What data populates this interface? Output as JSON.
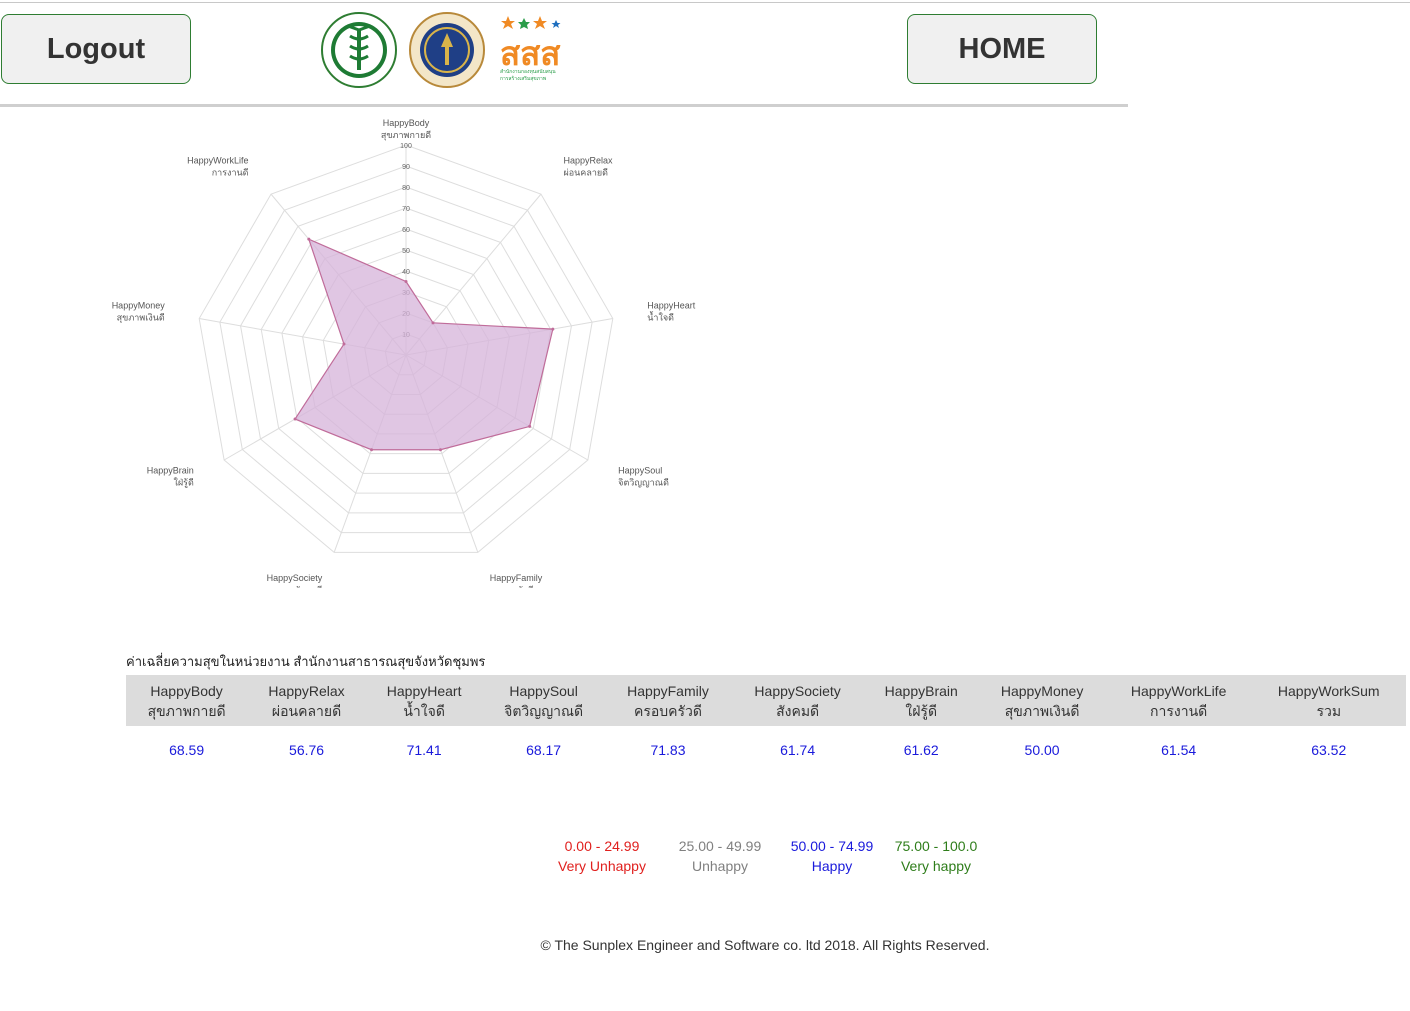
{
  "header": {
    "logout_label": "Logout",
    "home_label": "HOME",
    "logo3_text": "สสส",
    "logo3_sub1": "สำนักงานกองทุนสนับสนุน",
    "logo3_sub2": "การสร้างเสริมสุขภาพ"
  },
  "chart_data": {
    "type": "radar",
    "axes": [
      {
        "en": "HappyBody",
        "th": "สุขภาพกายดี"
      },
      {
        "en": "HappyRelax",
        "th": "ผ่อนคลายดี"
      },
      {
        "en": "HappyHeart",
        "th": "น้ำใจดี"
      },
      {
        "en": "HappySoul",
        "th": "จิตวิญญาณดี"
      },
      {
        "en": "HappyFamily",
        "th": "ครอบครัวดี"
      },
      {
        "en": "HappySociety",
        "th": "สังคมดี"
      },
      {
        "en": "HappyBrain",
        "th": "ใฝ่รู้ดี"
      },
      {
        "en": "HappyMoney",
        "th": "สุขภาพเงินดี"
      },
      {
        "en": "HappyWorkLife",
        "th": "การงานดี"
      }
    ],
    "ticks": [
      10,
      20,
      30,
      40,
      50,
      60,
      70,
      80,
      90,
      100
    ],
    "range": [
      0,
      100
    ],
    "series": [
      {
        "values": [
          35,
          20,
          71,
          68,
          48,
          48,
          61,
          30,
          72
        ]
      }
    ],
    "colors": {
      "fill": "#d5b3d9",
      "stroke": "#c06c9a",
      "grid": "#dddddd"
    }
  },
  "table": {
    "caption": "ค่าเฉลี่ยความสุขในหน่วยงาน สำนักงานสาธารณสุขจังหวัดชุมพร",
    "headers": [
      {
        "en": "HappyBody",
        "th": "สุขภาพกายดี"
      },
      {
        "en": "HappyRelax",
        "th": "ผ่อนคลายดี"
      },
      {
        "en": "HappyHeart",
        "th": "น้ำใจดี"
      },
      {
        "en": "HappySoul",
        "th": "จิตวิญญาณดี"
      },
      {
        "en": "HappyFamily",
        "th": "ครอบครัวดี"
      },
      {
        "en": "HappySociety",
        "th": "สังคมดี"
      },
      {
        "en": "HappyBrain",
        "th": "ใฝ่รู้ดี"
      },
      {
        "en": "HappyMoney",
        "th": "สุขภาพเงินดี"
      },
      {
        "en": "HappyWorkLife",
        "th": "การงานดี"
      },
      {
        "en": "HappyWorkSum",
        "th": "รวม"
      }
    ],
    "values": [
      "68.59",
      "56.76",
      "71.41",
      "68.17",
      "71.83",
      "61.74",
      "61.62",
      "50.00",
      "61.54",
      "63.52"
    ]
  },
  "legend": [
    {
      "range": "0.00 - 24.99",
      "label": "Very Unhappy",
      "color": "#e0201e"
    },
    {
      "range": "25.00 - 49.99",
      "label": "Unhappy",
      "color": "#808080"
    },
    {
      "range": "50.00 - 74.99",
      "label": "Happy",
      "color": "#1a1adb"
    },
    {
      "range": "75.00 - 100.0",
      "label": "Very happy",
      "color": "#2e7d1a"
    }
  ],
  "footer": "© The Sunplex Engineer and Software co. ltd 2018. All Rights Reserved."
}
